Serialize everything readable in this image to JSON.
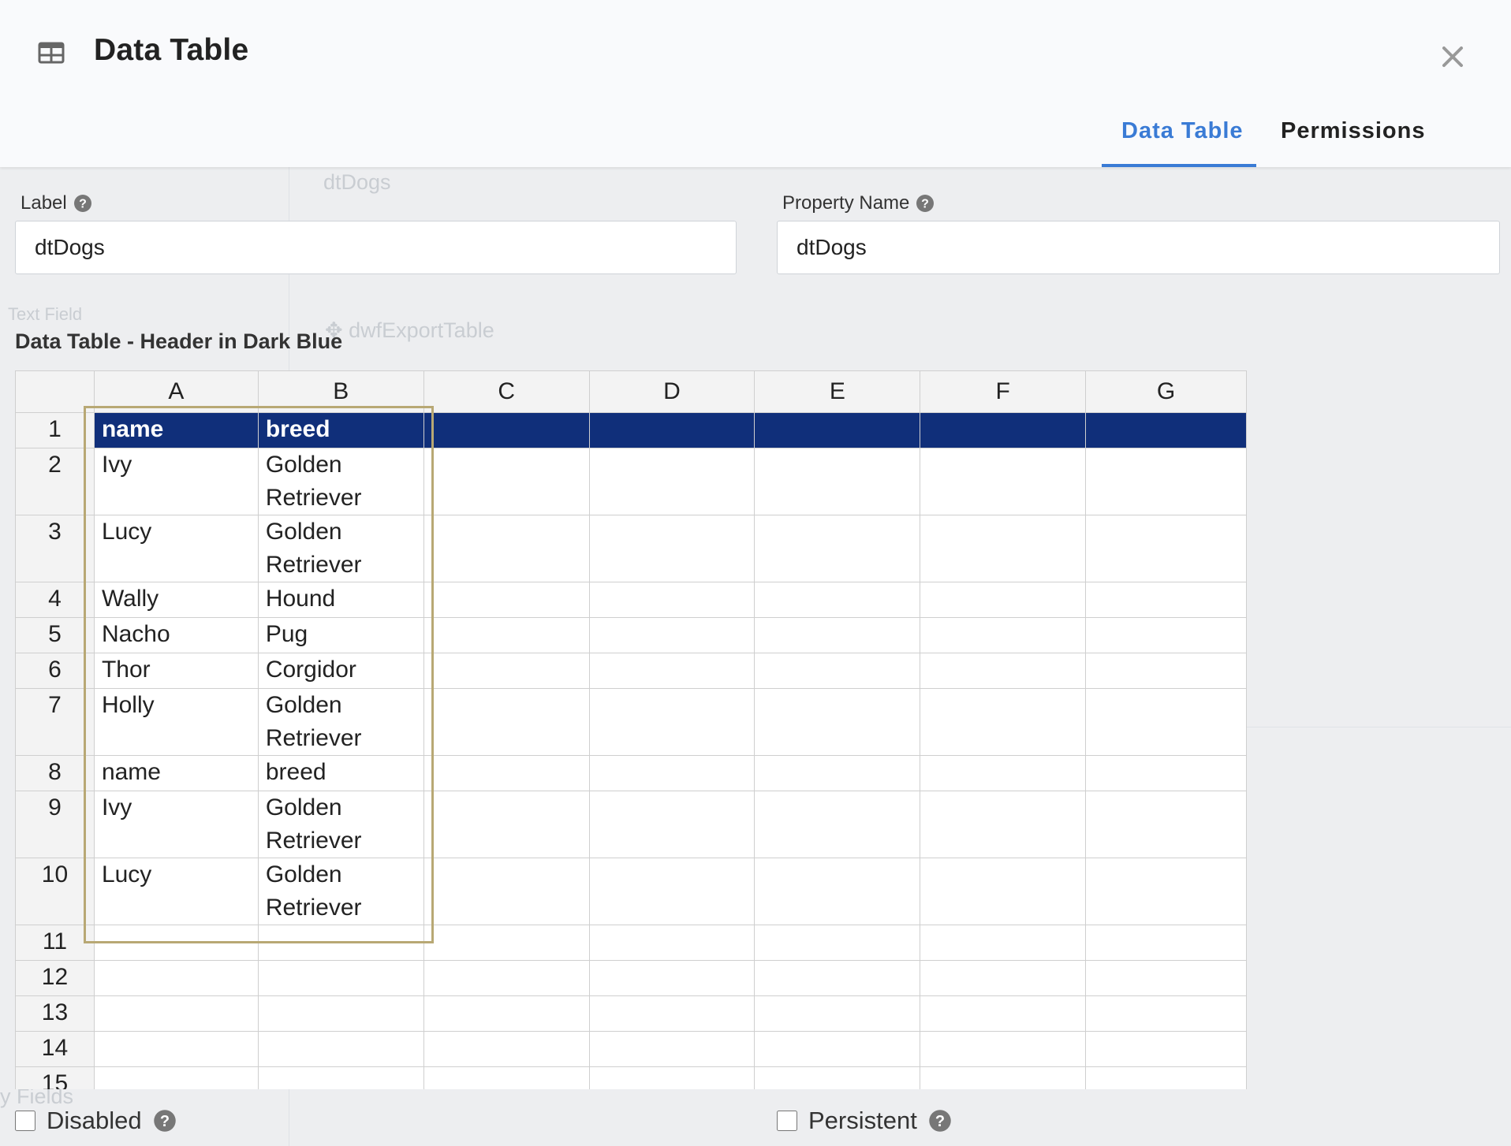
{
  "header": {
    "icon": "table-icon",
    "title": "Data Table",
    "close_icon": "close-icon"
  },
  "tabs": [
    {
      "label": "Data Table",
      "active": true
    },
    {
      "label": "Permissions",
      "active": false
    }
  ],
  "fields": {
    "label": {
      "label": "Label",
      "value": "dtDogs",
      "help_icon": "question-circle-icon"
    },
    "property_name": {
      "label": "Property Name",
      "value": "dtDogs",
      "help_icon": "question-circle-icon"
    }
  },
  "section_title": "Data Table - Header in Dark Blue",
  "sheet": {
    "columns": [
      "A",
      "B",
      "C",
      "D",
      "E",
      "F",
      "G"
    ],
    "rows": [
      {
        "num": "1",
        "a": "name",
        "b": "breed"
      },
      {
        "num": "2",
        "a": "Ivy",
        "b": "Golden Retriever"
      },
      {
        "num": "3",
        "a": "Lucy",
        "b": "Golden Retriever"
      },
      {
        "num": "4",
        "a": "Wally",
        "b": "Hound"
      },
      {
        "num": "5",
        "a": "Nacho",
        "b": "Pug"
      },
      {
        "num": "6",
        "a": "Thor",
        "b": "Corgidor"
      },
      {
        "num": "7",
        "a": "Holly",
        "b": "Golden Retriever"
      },
      {
        "num": "8",
        "a": "name",
        "b": "breed"
      },
      {
        "num": "9",
        "a": "Ivy",
        "b": "Golden Retriever"
      },
      {
        "num": "10",
        "a": "Lucy",
        "b": "Golden Retriever"
      },
      {
        "num": "11",
        "a": "",
        "b": ""
      },
      {
        "num": "12",
        "a": "",
        "b": ""
      },
      {
        "num": "13",
        "a": "",
        "b": ""
      },
      {
        "num": "14",
        "a": "",
        "b": ""
      },
      {
        "num": "15",
        "a": "",
        "b": ""
      }
    ],
    "header_color": "#102f7a",
    "selection_color": "#b8a874"
  },
  "options": {
    "disabled": {
      "label": "Disabled",
      "checked": false,
      "help_icon": "question-circle-icon"
    },
    "persistent": {
      "label": "Persistent",
      "checked": false,
      "help_icon": "question-circle-icon"
    }
  },
  "background": {
    "items": [
      "dtDogs",
      "Text Field",
      "dwfExportTable",
      "y Fields"
    ]
  },
  "colors": {
    "accent": "#3a7bd5",
    "header_bg": "#102f7a"
  }
}
